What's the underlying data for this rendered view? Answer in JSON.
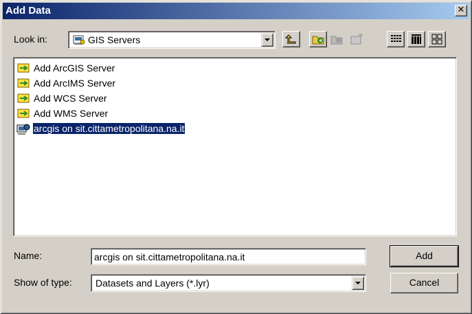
{
  "window": {
    "title": "Add Data",
    "close_glyph": "✕"
  },
  "look_in": {
    "label": "Look in:",
    "value": "GIS Servers",
    "icon": "gis-servers-icon"
  },
  "toolbar": {
    "buttons": [
      "up-one-level-icon",
      "connect-to-folder-icon",
      "disconnect-folder-icon",
      "new-folder-icon",
      "list-view-icon",
      "details-view-icon",
      "thumbnails-view-icon"
    ]
  },
  "list": {
    "items": [
      {
        "label": "Add ArcGIS Server",
        "icon": "add-server-icon"
      },
      {
        "label": "Add ArcIMS Server",
        "icon": "add-server-icon"
      },
      {
        "label": "Add WCS Server",
        "icon": "add-server-icon"
      },
      {
        "label": "Add WMS Server",
        "icon": "add-server-icon"
      },
      {
        "label": "arcgis on sit.cittametropolitana.na.it",
        "icon": "server-connection-icon",
        "selected": true
      }
    ]
  },
  "name": {
    "label": "Name:",
    "value": "arcgis on sit.cittametropolitana.na.it"
  },
  "type": {
    "label": "Show of type:",
    "value": "Datasets and Layers (*.lyr)"
  },
  "buttons": {
    "add": "Add",
    "cancel": "Cancel"
  },
  "colors": {
    "titlebar": "#0a246a",
    "face": "#d4d0c8",
    "selection": "#0a246a"
  }
}
